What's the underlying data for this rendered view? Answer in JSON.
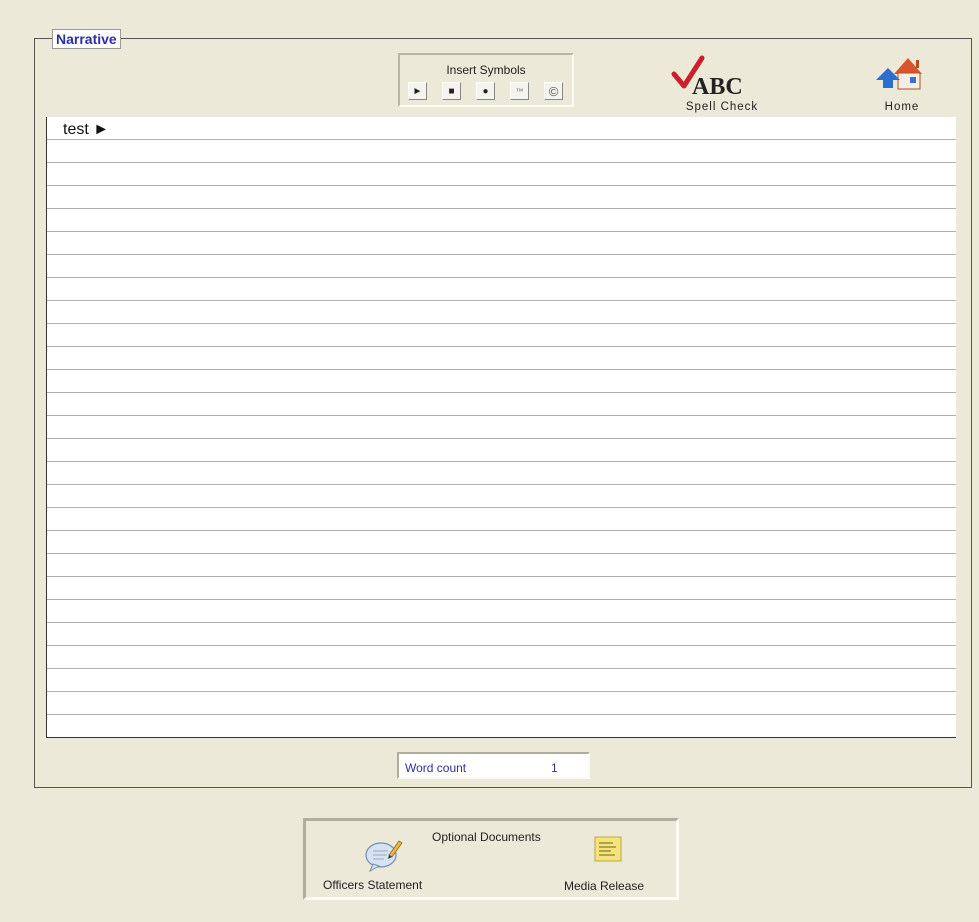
{
  "narrative": {
    "title": "Narrative",
    "text": "test ►"
  },
  "insert_symbols": {
    "title": "Insert Symbols",
    "symbols": [
      "►",
      "■",
      "●",
      "™",
      "©"
    ]
  },
  "toolbar": {
    "spell_check_label": "Spell Check",
    "home_label": "Home"
  },
  "word_count": {
    "label": "Word count",
    "value": "1"
  },
  "optional_documents": {
    "title": "Optional Documents",
    "officers_statement_label": "Officers Statement",
    "media_release_label": "Media Release"
  },
  "colors": {
    "background": "#ece9d8",
    "accent_text": "#2b2fa6",
    "spell_check": "#cc1f2a",
    "home_arrow": "#2a6fcf",
    "home_roof": "#d9542b"
  }
}
